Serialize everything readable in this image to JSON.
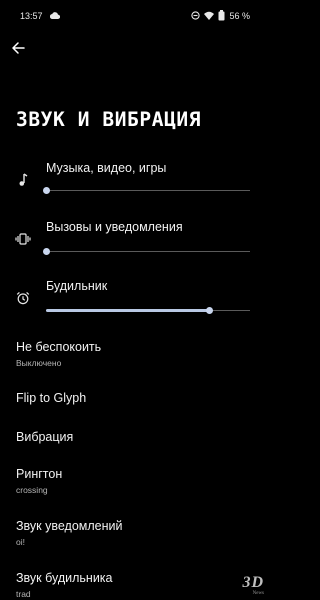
{
  "status_bar": {
    "time": "13:57",
    "battery": "56 %"
  },
  "page": {
    "title": "ЗВУК И ВИБРАЦИЯ"
  },
  "volume": [
    {
      "label": "Музыка, видео, игры",
      "icon": "music-note-icon",
      "level": 0.0
    },
    {
      "label": "Вызовы и уведомления",
      "icon": "vibrate-icon",
      "level": 0.0
    },
    {
      "label": "Будильник",
      "icon": "alarm-icon",
      "level": 0.8
    }
  ],
  "settings": [
    {
      "title": "Не беспокоить",
      "subtitle": "Выключено"
    },
    {
      "title": "Flip to Glyph",
      "subtitle": ""
    },
    {
      "title": "Вибрация",
      "subtitle": ""
    },
    {
      "title": "Рингтон",
      "subtitle": "crossing"
    },
    {
      "title": "Звук уведомлений",
      "subtitle": "oi!"
    },
    {
      "title": "Звук будильника",
      "subtitle": "trad"
    }
  ],
  "watermark": {
    "logo": "3D",
    "sub": "News"
  },
  "colors": {
    "background": "#000000",
    "slider_active": "#b9c9e4",
    "slider_inactive": "#5a5a5a"
  }
}
